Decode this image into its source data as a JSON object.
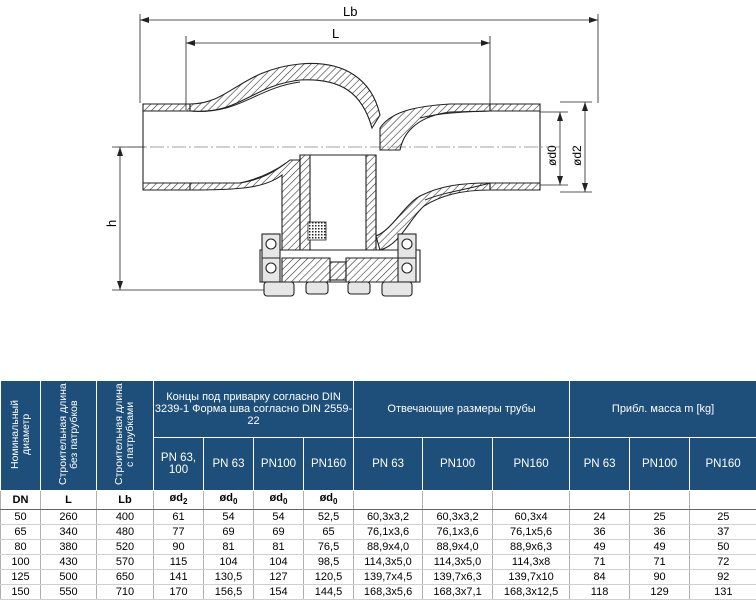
{
  "drawing": {
    "dim_lb": "Lb",
    "dim_l": "L",
    "dim_h": "h",
    "dim_d0": "ød0",
    "dim_d2": "ød2"
  },
  "table": {
    "head_dn": "Номинальный диаметр",
    "head_l": "Строительная длина без патрубков",
    "head_lb": "Строительная длина с патрубками",
    "head_ends": "Концы под приварку согласно DIN 3239-1 Форма шва согласно DIN 2559-22",
    "head_pipe": "Отвечающие размеры трубы",
    "head_mass": "Прибл. масса m [kg]",
    "sub_ends": [
      "PN 63, 100",
      "PN 63",
      "PN100",
      "PN160"
    ],
    "sub_pipe": [
      "PN 63",
      "PN100",
      "PN160"
    ],
    "sub_mass": [
      "PN 63",
      "PN100",
      "PN160"
    ],
    "symbols": [
      "DN",
      "L",
      "Lb",
      "ød2",
      "ød0",
      "ød0",
      "ød0",
      "",
      "",
      "",
      "",
      "",
      ""
    ],
    "rows": [
      [
        "50",
        "260",
        "400",
        "61",
        "54",
        "54",
        "52,5",
        "60,3x3,2",
        "60,3x3,2",
        "60,3x4",
        "24",
        "25",
        "25"
      ],
      [
        "65",
        "340",
        "480",
        "77",
        "69",
        "69",
        "65",
        "76,1x3,6",
        "76,1x3,6",
        "76,1x5,6",
        "36",
        "36",
        "37"
      ],
      [
        "80",
        "380",
        "520",
        "90",
        "81",
        "81",
        "76,5",
        "88,9x4,0",
        "88,9x4,0",
        "88,9x6,3",
        "49",
        "49",
        "50"
      ],
      [
        "100",
        "430",
        "570",
        "115",
        "104",
        "104",
        "98,5",
        "114,3x5,0",
        "114,3x5,0",
        "114,3x8",
        "71",
        "71",
        "72"
      ],
      [
        "125",
        "500",
        "650",
        "141",
        "130,5",
        "127",
        "120,5",
        "139,7x4,5",
        "139,7x6,3",
        "139,7x10",
        "84",
        "90",
        "92"
      ],
      [
        "150",
        "550",
        "710",
        "170",
        "156,5",
        "154",
        "144,5",
        "168,3x5,6",
        "168,3x7,1",
        "168,3x12,5",
        "118",
        "129",
        "131"
      ]
    ]
  }
}
